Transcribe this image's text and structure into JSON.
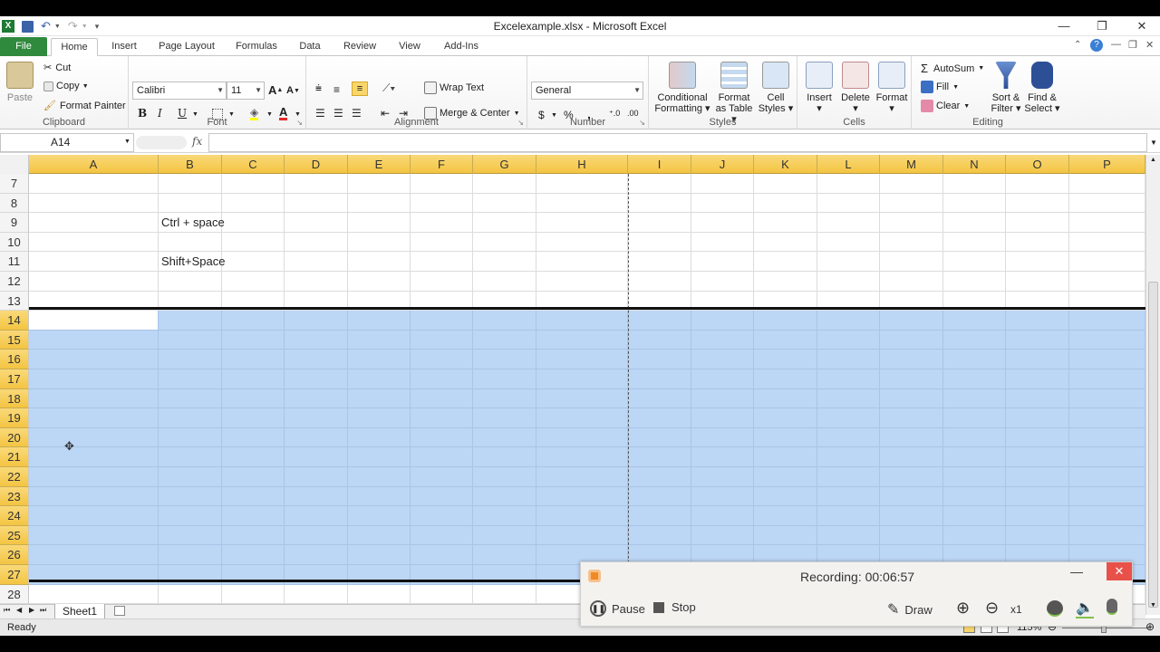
{
  "window": {
    "title": "Excelexample.xlsx - Microsoft Excel"
  },
  "tabs": [
    "File",
    "Home",
    "Insert",
    "Page Layout",
    "Formulas",
    "Data",
    "Review",
    "View",
    "Add-Ins"
  ],
  "ribbon": {
    "clipboard": {
      "paste": "Paste",
      "cut": "Cut",
      "copy": "Copy",
      "format_painter": "Format Painter",
      "label": "Clipboard"
    },
    "font": {
      "name": "Calibri",
      "size": "11",
      "bold": "B",
      "italic": "I",
      "underline": "U",
      "label": "Font"
    },
    "alignment": {
      "wrap_text": "Wrap Text",
      "merge_center": "Merge & Center",
      "label": "Alignment"
    },
    "number": {
      "format": "General",
      "currency": "$",
      "percent": "%",
      "comma": ",",
      "label": "Number"
    },
    "styles": {
      "conditional": "Conditional",
      "conditional2": "Formatting",
      "format_table": "Format",
      "format_table2": "as Table",
      "cell_styles": "Cell",
      "cell_styles2": "Styles",
      "label": "Styles"
    },
    "cells": {
      "insert": "Insert",
      "delete": "Delete",
      "format": "Format",
      "label": "Cells"
    },
    "editing": {
      "autosum": "AutoSum",
      "fill": "Fill",
      "clear": "Clear",
      "sort": "Sort &",
      "sort2": "Filter",
      "find": "Find &",
      "find2": "Select",
      "label": "Editing"
    }
  },
  "formula_bar": {
    "name_box": "A14",
    "fx": "fx",
    "value": ""
  },
  "columns": [
    "A",
    "B",
    "C",
    "D",
    "E",
    "F",
    "G",
    "H",
    "I",
    "J",
    "K",
    "L",
    "M",
    "N",
    "O",
    "P"
  ],
  "rows": [
    {
      "num": "7",
      "b": ""
    },
    {
      "num": "8",
      "b": ""
    },
    {
      "num": "9",
      "b": "Ctrl + space"
    },
    {
      "num": "10",
      "b": ""
    },
    {
      "num": "11",
      "b": "Shift+Space"
    },
    {
      "num": "12",
      "b": ""
    },
    {
      "num": "13",
      "b": ""
    },
    {
      "num": "14",
      "b": ""
    },
    {
      "num": "15",
      "b": ""
    },
    {
      "num": "16",
      "b": ""
    },
    {
      "num": "17",
      "b": ""
    },
    {
      "num": "18",
      "b": ""
    },
    {
      "num": "19",
      "b": ""
    },
    {
      "num": "20",
      "b": ""
    },
    {
      "num": "21",
      "b": ""
    },
    {
      "num": "22",
      "b": ""
    },
    {
      "num": "23",
      "b": ""
    },
    {
      "num": "24",
      "b": ""
    },
    {
      "num": "25",
      "b": ""
    },
    {
      "num": "26",
      "b": ""
    },
    {
      "num": "27",
      "b": ""
    },
    {
      "num": "28",
      "b": ""
    }
  ],
  "selected_rows": [
    "14",
    "15",
    "16",
    "17",
    "18",
    "19",
    "20",
    "21",
    "22",
    "23",
    "24",
    "25",
    "26",
    "27"
  ],
  "sheet_tab": "Sheet1",
  "status": {
    "ready": "Ready",
    "zoom": "115%"
  },
  "recorder": {
    "text": "Recording:  00:06:57",
    "pause": "Pause",
    "stop": "Stop",
    "draw": "Draw",
    "zoom_level": "x1"
  }
}
